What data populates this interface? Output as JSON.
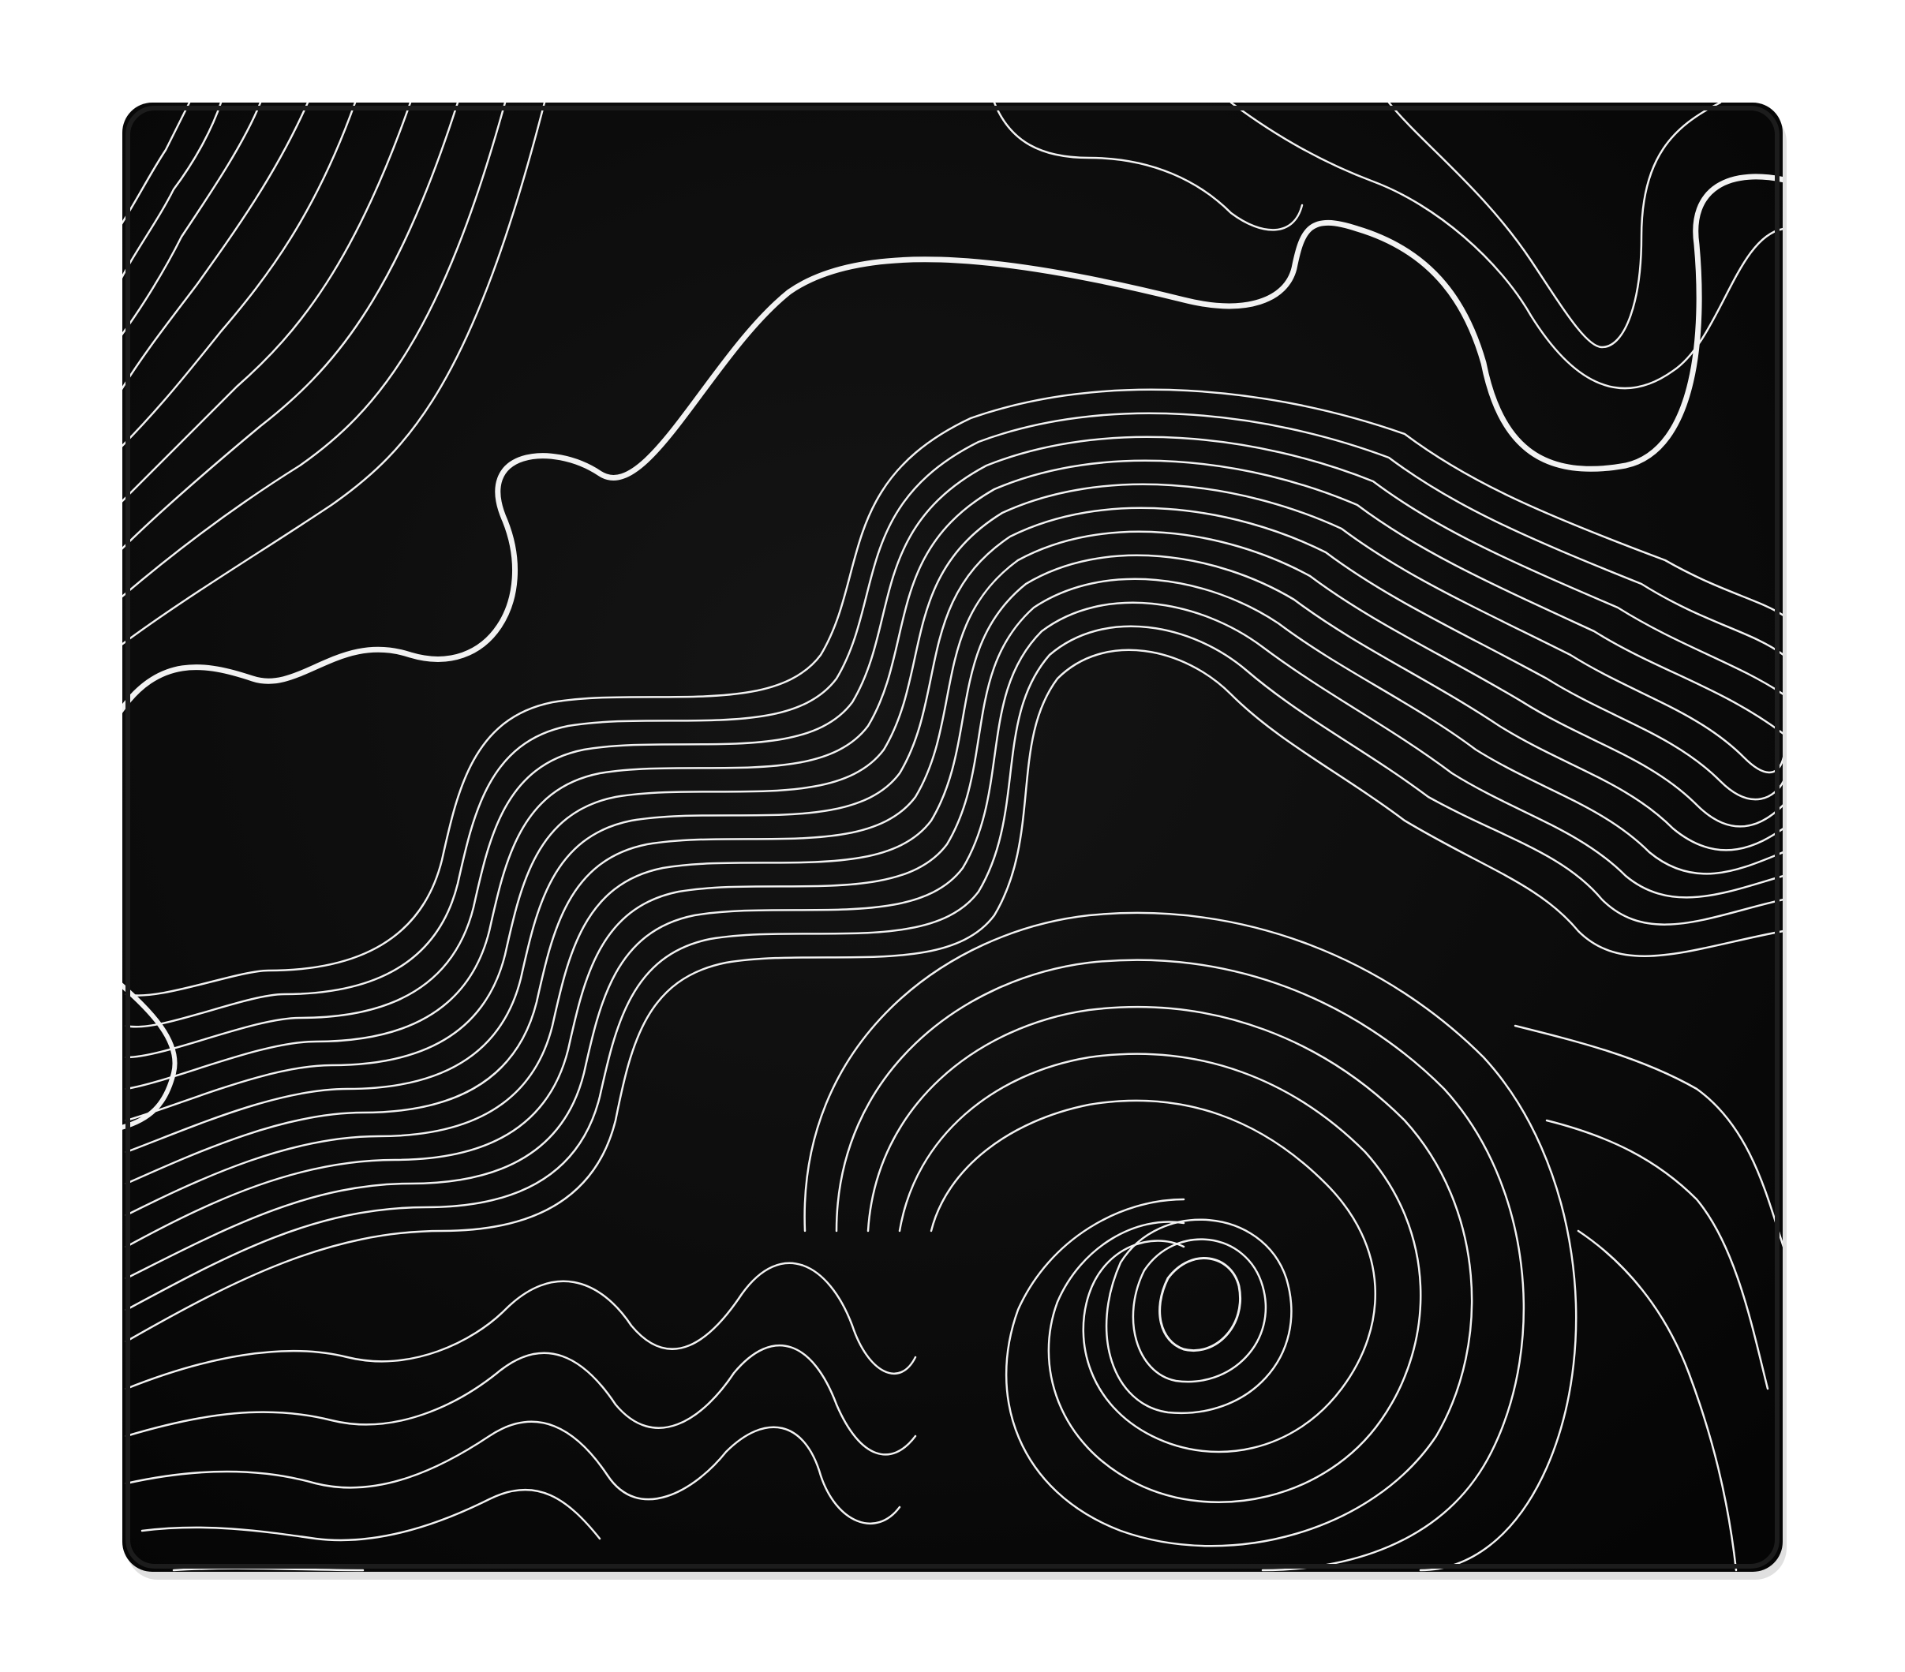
{
  "scene": {
    "subject": "mousepad",
    "pattern": "topographic-contour-lines",
    "colors": {
      "background": "#ffffff",
      "pad_surface": "#0a0a0a",
      "pad_stitching": "#1c1c1c",
      "contour_lines": "#f2f2f2"
    }
  }
}
